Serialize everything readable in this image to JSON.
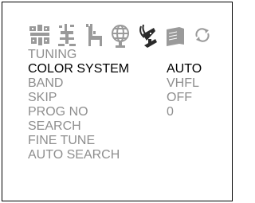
{
  "menu": {
    "title": "TUNING",
    "items": [
      {
        "label": "COLOR SYSTEM",
        "value": "AUTO"
      },
      {
        "label": "BAND",
        "value": "VHFL"
      },
      {
        "label": "SKIP",
        "value": "OFF"
      },
      {
        "label": "PROG NO",
        "value": "0"
      },
      {
        "label": "SEARCH",
        "value": ""
      },
      {
        "label": "FINE TUNE",
        "value": ""
      },
      {
        "label": "AUTO SEARCH",
        "value": ""
      }
    ]
  },
  "icons": [
    "picture-settings-icon",
    "sound-settings-icon",
    "function-settings-icon",
    "globe-icon",
    "satellite-dish-icon",
    "teletext-icon",
    "refresh-icon"
  ],
  "colors": {
    "selected": "#000000",
    "dim": "#8e8e8e",
    "icon": "#9a9a9a"
  }
}
